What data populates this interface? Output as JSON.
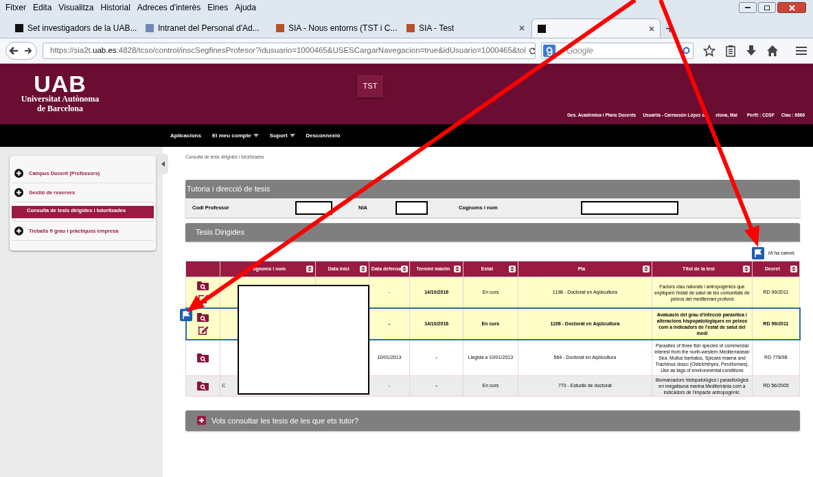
{
  "browser": {
    "menu": [
      "Fitxer",
      "Edita",
      "Visualitza",
      "Historial",
      "Adreces d'interès",
      "Eines",
      "Ajuda"
    ],
    "tabs": [
      {
        "title": "Set investigadors de la UAB...",
        "selected": false
      },
      {
        "title": "Intranet del Personal d'Ad...",
        "selected": false
      },
      {
        "title": "SIA - Nous entorns (TST i C...",
        "selected": false
      },
      {
        "title": "SIA - Test",
        "selected": false
      },
      {
        "selected": true
      }
    ],
    "url": "https://sia2t.**uab.es**:4828/tcso/control/inscSegfinesProfesor?idusuario=1000465&USESCargarNavegacion=true&idUsuario=1000465&tol",
    "search": {
      "placeholder": "Google"
    }
  },
  "header": {
    "logo": "UAB",
    "logo_lines": [
      "Universitat Autònoma",
      "de Barcelona"
    ],
    "env_badge": "TST",
    "info": [
      "Ges. Acadèmica i Plans Docents",
      "Usuari/a - Carrassón López d",
      "etona, Mai",
      "Perfil : CDSF",
      "Clau : 6666"
    ]
  },
  "nav": [
    {
      "label": "Aplicacions",
      "dropdown": false
    },
    {
      "label": "El meu compte",
      "dropdown": true
    },
    {
      "label": "Suport",
      "dropdown": true
    },
    {
      "label": "Desconnexió",
      "dropdown": false
    }
  ],
  "sidebar": {
    "items": [
      {
        "label": "Campus Docent (Professors)",
        "selected": false
      },
      {
        "label": "Gestió de reserves",
        "selected": false
      },
      {
        "label": "Consulta de tesis dirigides i tutoritzades",
        "selected": true
      },
      {
        "label": "Treballs fi grau i pràctiques empresa",
        "selected": false
      }
    ]
  },
  "breadcrumb": "Consulta de tesis dirigides i tutoritzades",
  "tutoria": {
    "title": "Tutoria i direcció de tesis",
    "fields": [
      {
        "label": "Codi Professor"
      },
      {
        "label": "NIA"
      },
      {
        "label": "Cognoms i nom"
      }
    ]
  },
  "dirigides": {
    "title": "Tesis Dirigides",
    "legend": "Hi ha canvis",
    "columns": [
      "ognoms i nom",
      "Data inici",
      "Data defensa",
      "Termini màxim",
      "Estat",
      "Pla",
      "Títol de la tesi",
      "Decret"
    ],
    "rows": [
      {
        "editable": true,
        "selected": false,
        "changed": false,
        "color": "#fffdc8",
        "data_defensa": "-",
        "termini": "14/10/2016",
        "estat": "En curs",
        "pla": "1198 - Doctorat en Aqüicultura",
        "titol": "Factors clau naturals i antropogènics que expliquen l'estat de salut de les comunitats de peixos del mediterrani profund",
        "decret": "RD 99/2011"
      },
      {
        "editable": true,
        "selected": true,
        "changed": true,
        "color": "#fffdc8",
        "data_defensa": "-",
        "termini": "14/10/2016",
        "estat": "En curs",
        "pla": "1198 - Doctorat en Aqüicultura",
        "titol": "Avaluació del grau d'infecció parasítica i alteracions hispopatològiques en peixos com a indicadors de l'estat de salut del medi",
        "decret": "RD 99/2011"
      },
      {
        "editable": false,
        "selected": false,
        "changed": false,
        "color": "#ffffff",
        "data_defensa": "10/01/2013",
        "termini": "-",
        "estat": "Llegida a 10/01/2013",
        "pla": "564 - Doctorat en Aqüicultura",
        "titol": "Parasites of three fish species of commercial interest from the north-western Mediterranean Sea: Mullus barbatus, Spicara maena and Trachinus draco (Osteichthyes, Perciformes). Use as tags of environmental conditions",
        "decret": "RD 778/98"
      },
      {
        "editable": false,
        "selected": false,
        "changed": false,
        "color": "#ececec",
        "name": "C",
        "data_defensa": "-",
        "termini": "-",
        "estat": "En curs",
        "pla": "770 - Estudis de doctorat",
        "titol": "Biomarcadors histopatològics i parasitològics en megafauna marina Mediterrània com a indicadors de l'impacte antropogènic.",
        "decret": "RD 56/2005"
      }
    ]
  },
  "tutor_section": {
    "title": "Vols consultar les tesis de les que ets tutor?",
    "expanded": false
  }
}
